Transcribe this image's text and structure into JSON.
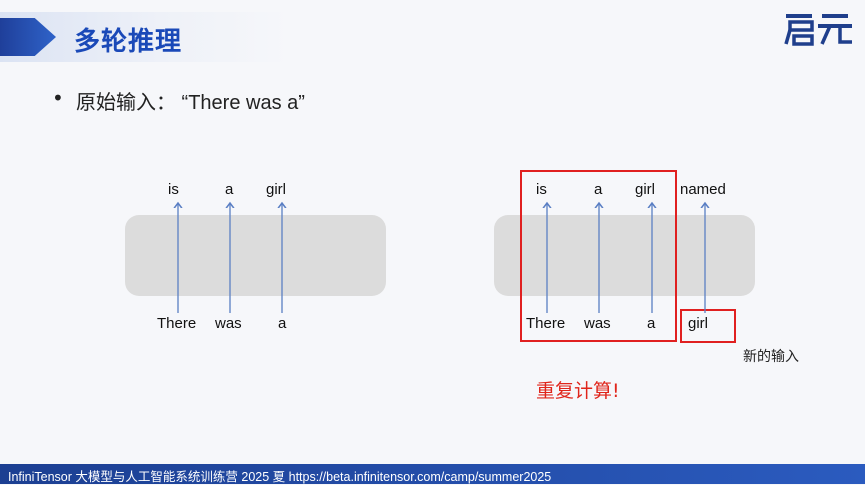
{
  "header": {
    "title": "多轮推理"
  },
  "logo": {
    "text": "启元"
  },
  "bullet": {
    "symbol": "•",
    "text": "原始输入：  “There was a”"
  },
  "left_diagram": {
    "outputs": [
      "is",
      "a",
      "girl"
    ],
    "inputs": [
      "There",
      "was",
      "a"
    ]
  },
  "right_diagram": {
    "outputs": [
      "is",
      "a",
      "girl",
      "named"
    ],
    "inputs": [
      "There",
      "was",
      "a",
      "girl"
    ],
    "new_input_label": "新的输入",
    "recompute_label": "重复计算!"
  },
  "footer": {
    "text": "InfiniTensor 大模型与人工智能系统训练营 2025 夏    https://beta.infinitensor.com/camp/summer2025"
  },
  "colors": {
    "title_blue": "#1a49b8",
    "arrow_blue": "#5a7fc4",
    "highlight_red": "#e02020",
    "footer_blue": "#1c3f92"
  }
}
